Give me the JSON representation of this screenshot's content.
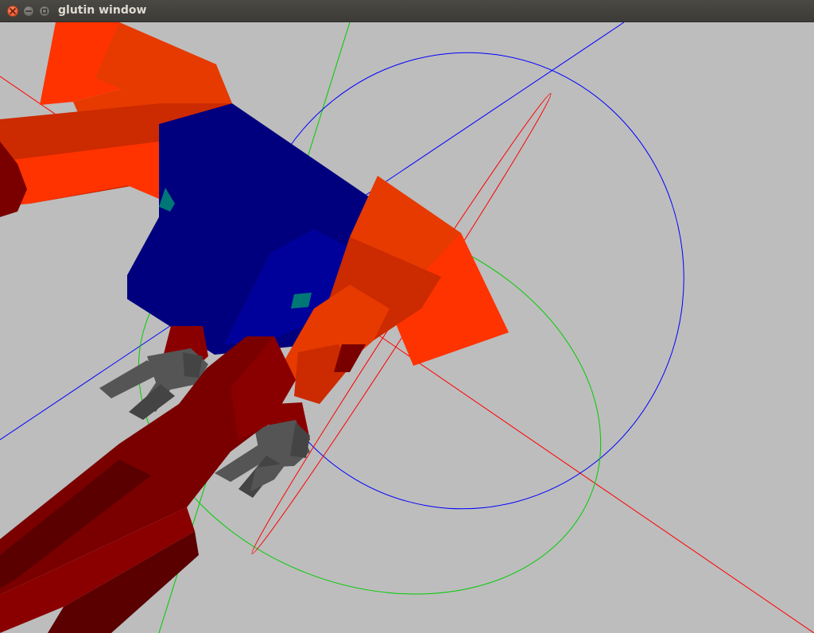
{
  "window": {
    "title": "glutin window",
    "controls": {
      "close": "close-icon",
      "minimize": "minimize-icon",
      "maximize": "maximize-icon"
    }
  },
  "scene": {
    "background": "#bdbdbd",
    "colors": {
      "body": "#00007f",
      "body_shade": "#00009a",
      "joint": "#007777",
      "arm_light": "#ff3300",
      "arm_mid": "#e63a00",
      "arm_dark": "#cc2a00",
      "limb_dark": "#7a0000",
      "limb_mid": "#8a0000",
      "limb_deep": "#5a0000",
      "claw": "#555555",
      "claw_dark": "#444444",
      "gizmo_x": "#ff0000",
      "gizmo_y": "#00cc00",
      "gizmo_z": "#0000ff"
    }
  }
}
